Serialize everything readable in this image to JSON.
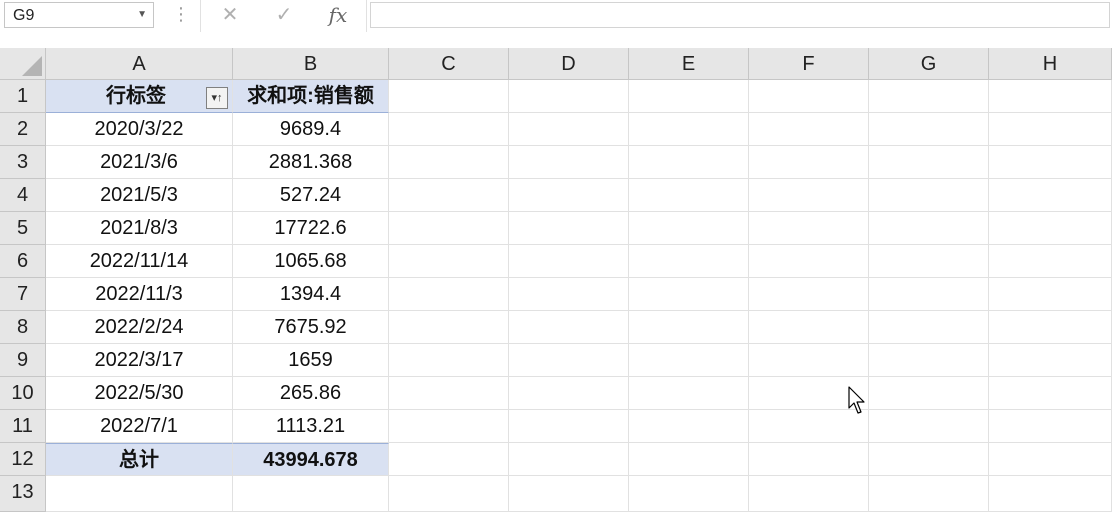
{
  "formula_bar": {
    "name_box": "G9",
    "cancel_icon": "✕",
    "enter_icon": "✓",
    "function_label": "fx",
    "formula_value": ""
  },
  "columns": [
    "A",
    "B",
    "C",
    "D",
    "E",
    "F",
    "G",
    "H"
  ],
  "rows": [
    "1",
    "2",
    "3",
    "4",
    "5",
    "6",
    "7",
    "8",
    "9",
    "10",
    "11",
    "12",
    "13"
  ],
  "pivot": {
    "header": {
      "row_label": "行标签",
      "value_label": "求和项:销售额"
    },
    "items": [
      {
        "date": "2020/3/22",
        "amount": "9689.4"
      },
      {
        "date": "2021/3/6",
        "amount": "2881.368"
      },
      {
        "date": "2021/5/3",
        "amount": "527.24"
      },
      {
        "date": "2021/8/3",
        "amount": "17722.6"
      },
      {
        "date": "2022/11/14",
        "amount": "1065.68"
      },
      {
        "date": "2022/11/3",
        "amount": "1394.4"
      },
      {
        "date": "2022/2/24",
        "amount": "7675.92"
      },
      {
        "date": "2022/3/17",
        "amount": "1659"
      },
      {
        "date": "2022/5/30",
        "amount": "265.86"
      },
      {
        "date": "2022/7/1",
        "amount": "1113.21"
      }
    ],
    "total": {
      "label": "总计",
      "amount": "43994.678"
    }
  },
  "colors": {
    "pivot_fill": "#d9e1f2",
    "header_fill": "#e6e6e6"
  }
}
